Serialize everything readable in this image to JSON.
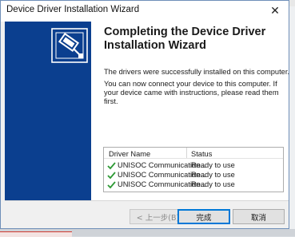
{
  "window": {
    "title": "Device Driver Installation Wizard",
    "close_glyph": "✕"
  },
  "main": {
    "heading": "Completing the Device Driver Installation Wizard",
    "message1": "The drivers were successfully installed on this computer.",
    "message2": "You can now connect your device to this computer. If your device came with instructions, please read them first."
  },
  "drivers": {
    "columns": [
      "Driver Name",
      "Status"
    ],
    "rows": [
      {
        "name": "UNISOC Communication...",
        "status": "Ready to use",
        "icon": "check-icon"
      },
      {
        "name": "UNISOC Communication...",
        "status": "Ready to use",
        "icon": "check-icon"
      },
      {
        "name": "UNISOC Communication...",
        "status": "Ready to use",
        "icon": "check-icon"
      }
    ]
  },
  "buttons": {
    "back": "< 上一步(B)",
    "finish": "完成",
    "cancel": "取消"
  },
  "colors": {
    "banner": "#0b3f8f",
    "check": "#2e9a35",
    "default_button_border": "#0078d7"
  }
}
